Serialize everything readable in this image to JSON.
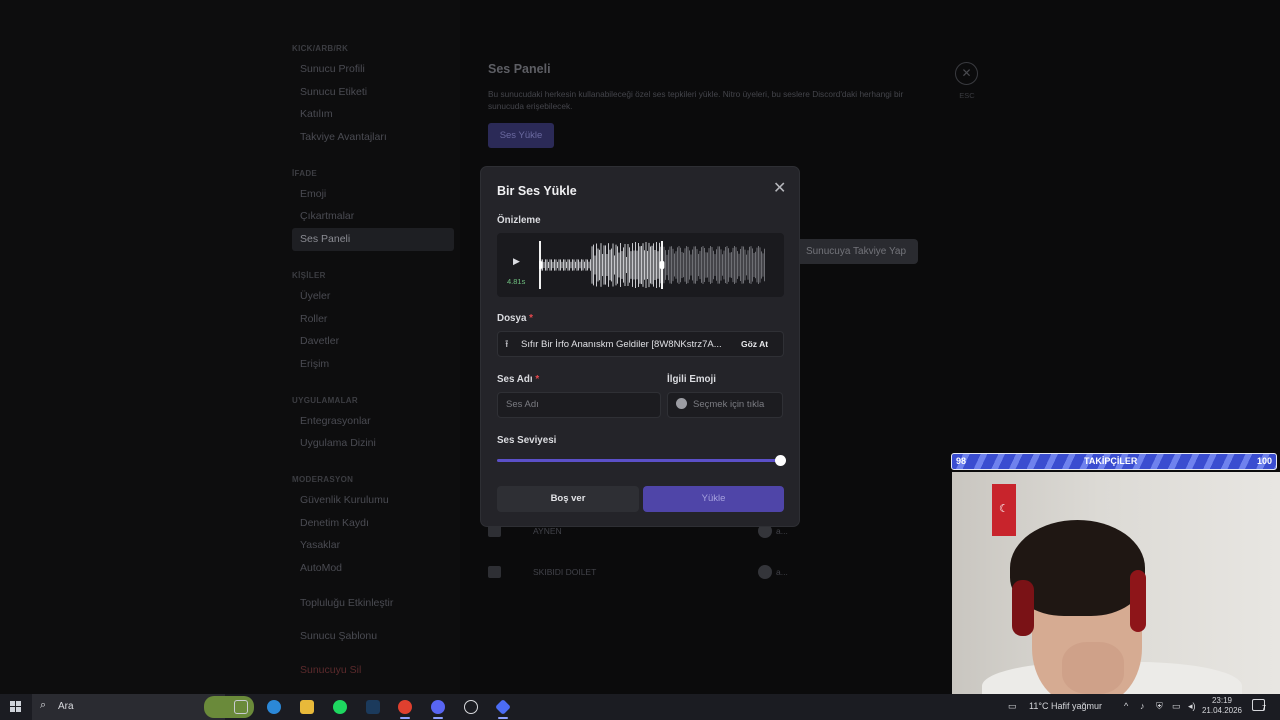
{
  "window_controls": {
    "minimize": "—",
    "maximize": "☐",
    "close": "✕"
  },
  "sidebar": {
    "sections": [
      {
        "header": "KICK/ARB/RK",
        "items": [
          "Sunucu Profili",
          "Sunucu Etiketi",
          "Katılım",
          "Takviye Avantajları"
        ]
      },
      {
        "header": "İFADE",
        "items": [
          "Emoji",
          "Çıkartmalar",
          "Ses Paneli"
        ]
      },
      {
        "header": "KİŞİLER",
        "items": [
          "Üyeler",
          "Roller",
          "Davetler",
          "Erişim"
        ]
      },
      {
        "header": "UYGULAMALAR",
        "items": [
          "Entegrasyonlar",
          "Uygulama Dizini"
        ]
      },
      {
        "header": "MODERASYON",
        "items": [
          "Güvenlik Kurulumu",
          "Denetim Kaydı",
          "Yasaklar",
          "AutoMod"
        ]
      }
    ],
    "extra_items": [
      "Topluluğu Etkinleştir",
      "Sunucu Şablonu",
      "Sunucuyu Sil"
    ],
    "active_item": "Ses Paneli"
  },
  "content": {
    "title": "Ses Paneli",
    "description": "Bu sunucudaki herkesin kullanabileceği özel ses tepkileri yükle. Nitro üyeleri, bu seslere Discord'daki herhangi bir sunucuda erişebilecek.",
    "upload_button": "Ses Yükle",
    "esc_label": "ESC",
    "boost_button": "Sunucuya Takviye Yap",
    "sounds": [
      {
        "name": "AYNEN",
        "author": "a..."
      },
      {
        "name": "SKIBIDI DOILET",
        "author": "a..."
      }
    ]
  },
  "modal": {
    "title": "Bir Ses Yükle",
    "preview_label": "Önizleme",
    "duration": "4.81s",
    "file_label": "Dosya",
    "file_name": "Sıfır Bir İrfo Ananıskm Geldiler [8W8NKstrz7A...",
    "browse_button": "Göz At",
    "name_label": "Ses Adı",
    "name_placeholder": "Ses Adı",
    "emoji_label": "İlgili Emoji",
    "emoji_placeholder": "Seçmek için tıkla",
    "volume_label": "Ses Seviyesi",
    "volume_value": 1.0,
    "cancel_button": "Boş ver",
    "submit_button": "Yükle",
    "required_mark": "*"
  },
  "overlay": {
    "followers_label": "TAKİPÇİLER",
    "followers_current": "98",
    "followers_goal": "100"
  },
  "taskbar": {
    "search_text": "Ara",
    "weather": "11°C  Hafif yağmur",
    "time": "23:19",
    "date": "21.04.2026",
    "notification_count": "7"
  },
  "colors": {
    "accent": "#5b50c8",
    "danger": "#e5484d",
    "follow_bar": "#3a4dd0"
  }
}
